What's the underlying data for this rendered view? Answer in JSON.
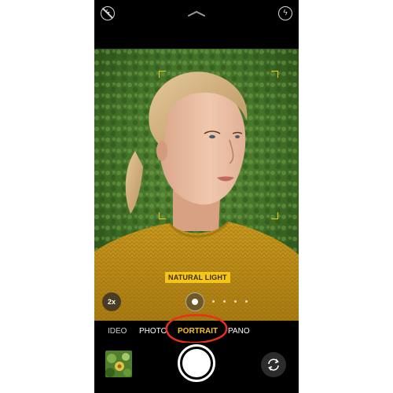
{
  "top_bar": {
    "flash_icon": "flash-off-icon",
    "live_icon": "live-photo-icon",
    "chevron_icon": "chevron-up-icon"
  },
  "viewfinder": {
    "lighting_badge": "NATURAL LIGHT",
    "zoom_label": "2x",
    "focus_frame_color": "#f5c518"
  },
  "modes": {
    "video": "IDEO",
    "photo": "PHOTO",
    "portrait": "PORTRAIT",
    "pano": "PANO",
    "selected": "PORTRAIT"
  },
  "annotation": {
    "ring_color": "#e8301c"
  },
  "bottom": {
    "thumbnail_icon": "last-photo-thumbnail",
    "shutter_icon": "shutter-button",
    "flip_icon": "camera-flip-icon"
  },
  "colors": {
    "accent": "#f5c518",
    "background": "#000000"
  }
}
